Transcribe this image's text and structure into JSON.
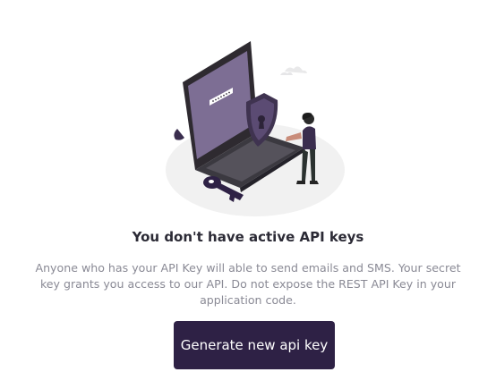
{
  "empty_state": {
    "illustration_icon": "security-laptop-shield-key-illustration",
    "title": "You don't have active API keys",
    "description": "Anyone who has your API Key will able to send emails and SMS. Your secret key grants you access to our API. Do not expose the REST API Key in your application code.",
    "button_label": "Generate new api key"
  },
  "colors": {
    "primary": "#2e2145",
    "text": "#2b2a35",
    "muted": "#8a8a95"
  }
}
